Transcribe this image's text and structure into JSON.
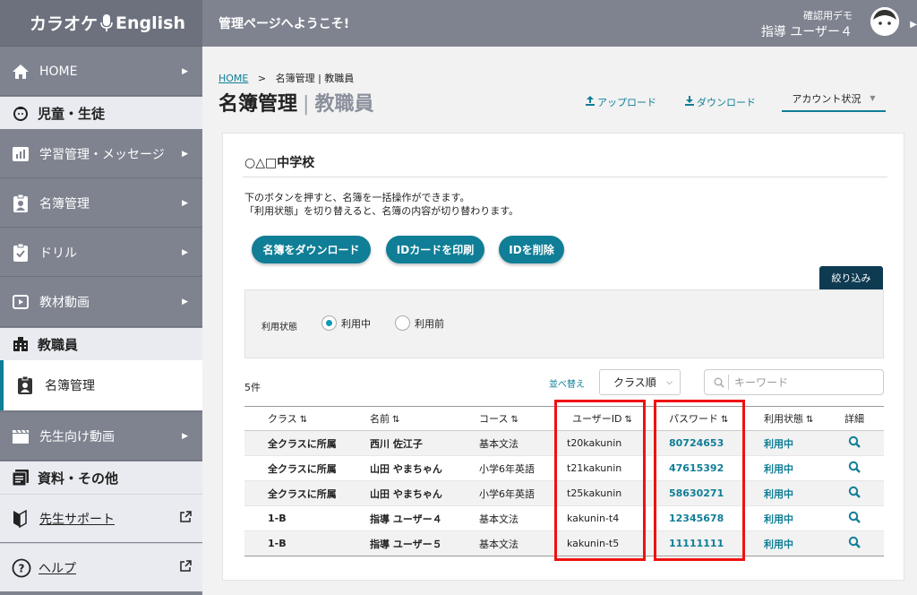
{
  "app": {
    "logo_left": "カラオケ",
    "logo_right": "English"
  },
  "topbar": {
    "welcome": "管理ページへようこそ!",
    "demo": "確認用デモ",
    "user": "指導 ユーザー４"
  },
  "sidebar": {
    "home": "HOME",
    "sec_students": "児童・生徒",
    "learning": "学習管理・メッセージ",
    "roster": "名簿管理",
    "drill": "ドリル",
    "video": "教材動画",
    "sec_staff": "教職員",
    "staff_roster": "名簿管理",
    "teacher_video": "先生向け動画",
    "sec_docs": "資料・その他",
    "support": "先生サポート",
    "help": "ヘルプ"
  },
  "breadcrumb": {
    "home": "HOME",
    "sep": ">",
    "current": "名簿管理 | 教職員"
  },
  "title": {
    "main": "名簿管理",
    "sep": "|",
    "sub": "教職員"
  },
  "toolbar": {
    "upload": "アップロード",
    "download": "ダウンロード",
    "account_status": "アカウント状況"
  },
  "card": {
    "school": "○△□中学校",
    "desc1": "下のボタンを押すと、名簿を一括操作ができます。",
    "desc2": "「利用状態」を切り替えると、名簿の内容が切り替わります。",
    "btn_download": "名簿をダウンロード",
    "btn_print": "IDカードを印刷",
    "btn_delete": "IDを削除",
    "filter_tab": "絞り込み",
    "filter_label": "利用状態",
    "radio_active": "利用中",
    "radio_before": "利用前",
    "count": "5件",
    "sort_label": "並べ替え",
    "sort_value": "クラス順",
    "search_placeholder": "キーワード"
  },
  "table": {
    "headers": [
      "クラス",
      "名前",
      "コース",
      "ユーザーID",
      "パスワード",
      "利用状態",
      "詳細"
    ],
    "rows": [
      [
        "全クラスに所属",
        "西川 佐江子",
        "基本文法",
        "t20kakunin",
        "80724653",
        "利用中"
      ],
      [
        "全クラスに所属",
        "山田 やまちゃん",
        "小学6年英語",
        "t21kakunin",
        "47615392",
        "利用中"
      ],
      [
        "全クラスに所属",
        "山田 やまちゃん",
        "小学6年英語",
        "t25kakunin",
        "58630271",
        "利用中"
      ],
      [
        "1-B",
        "指導 ユーザー４",
        "基本文法",
        "kakunin-t4",
        "12345678",
        "利用中"
      ],
      [
        "1-B",
        "指導 ユーザー５",
        "基本文法",
        "kakunin-t5",
        "11111111",
        "利用中"
      ]
    ]
  },
  "colors": {
    "accent": "#0f7e96",
    "sidebar": "#7e838f",
    "highlight": "#ef1111"
  }
}
